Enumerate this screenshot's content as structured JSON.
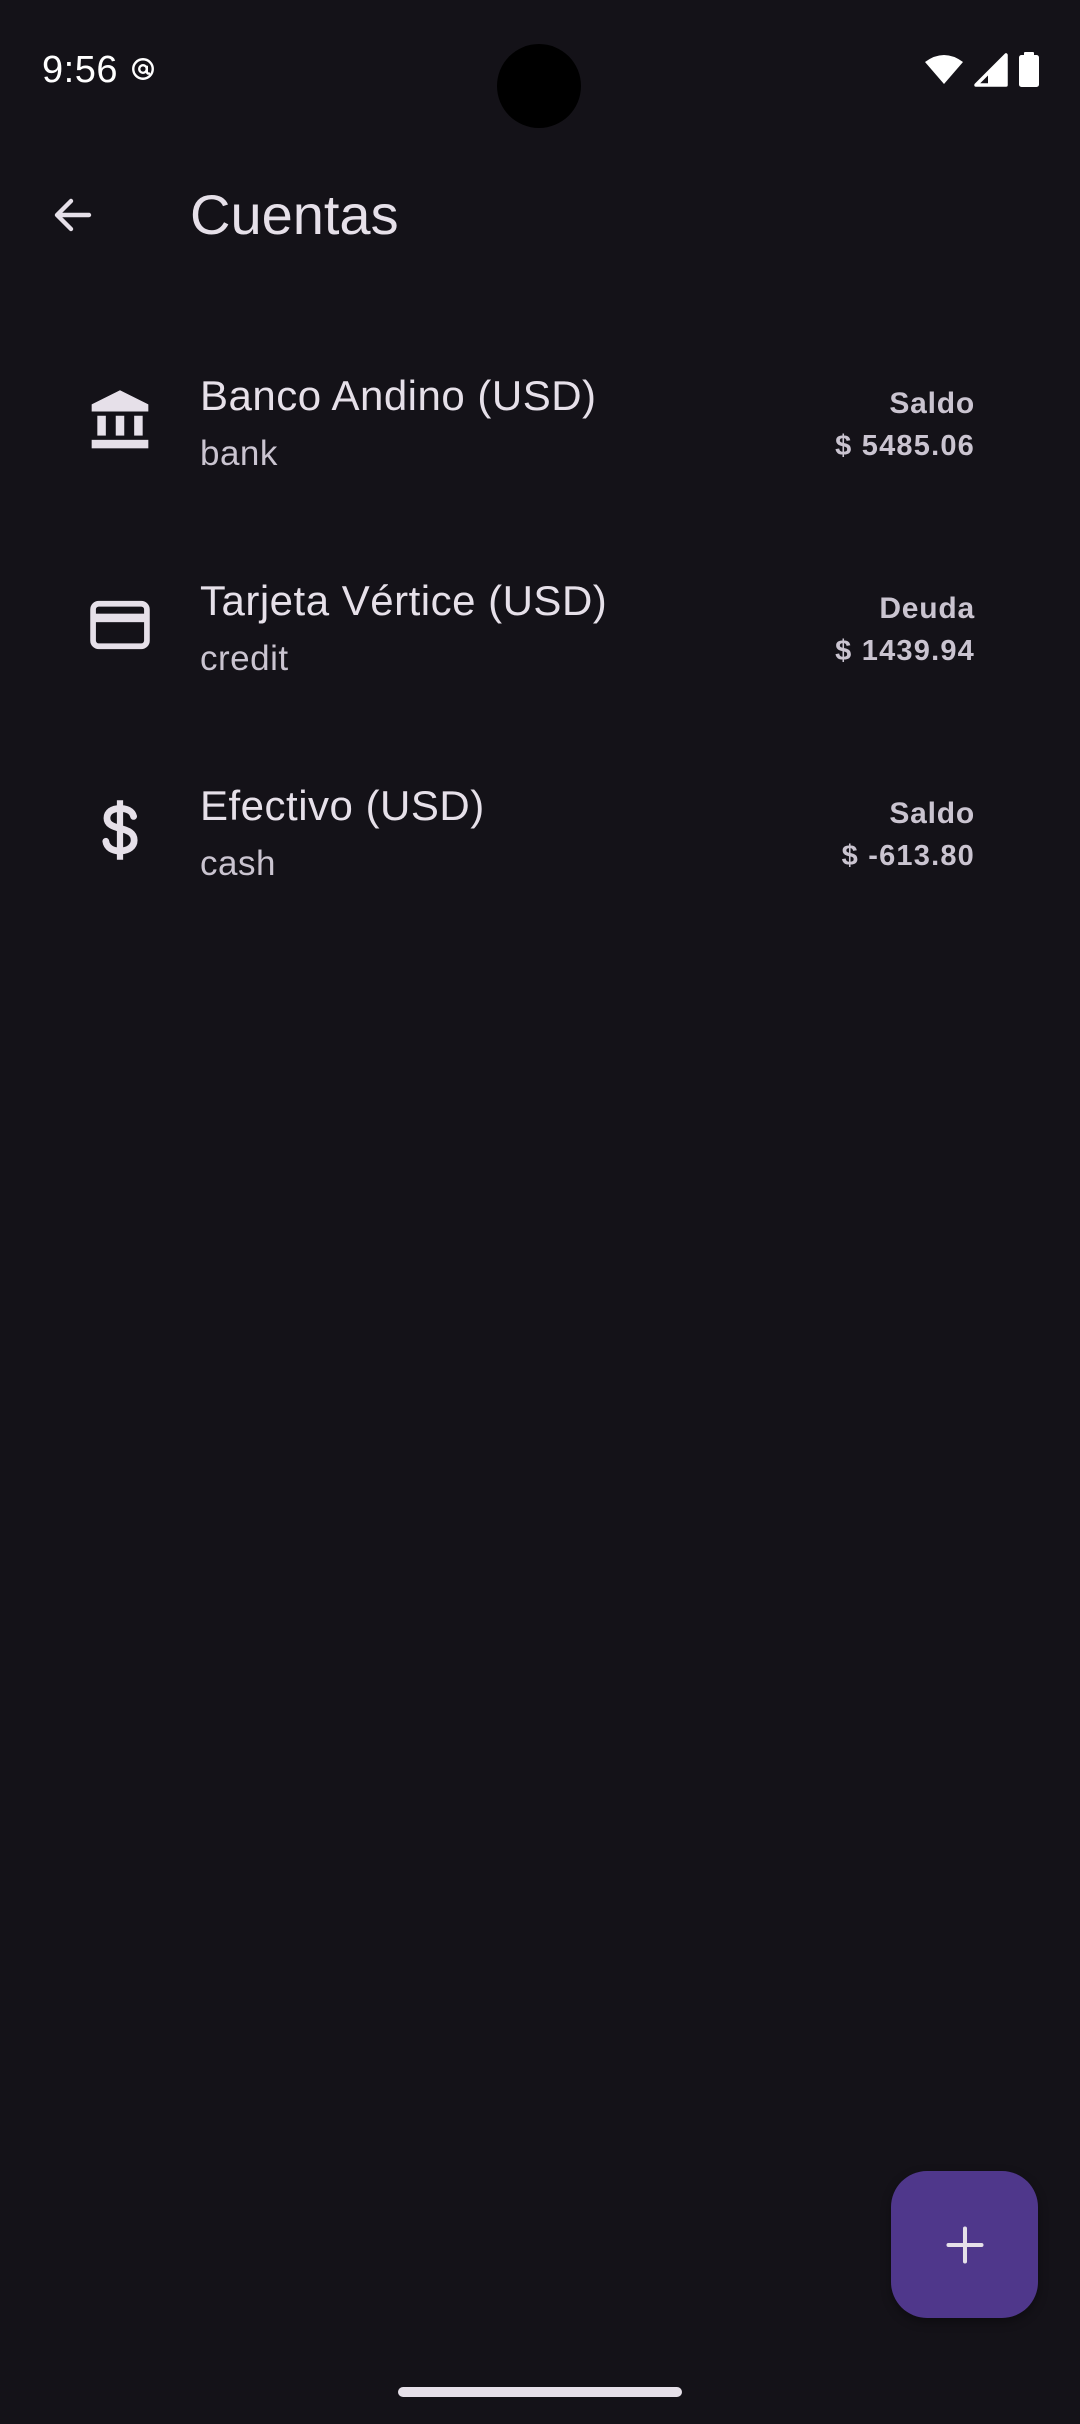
{
  "status_bar": {
    "time": "9:56",
    "app_icon": "at-sign-icon",
    "icons": [
      "wifi-icon",
      "cell-signal-icon",
      "battery-icon"
    ]
  },
  "app_bar": {
    "back_icon": "arrow-back-icon",
    "title": "Cuentas"
  },
  "accounts": [
    {
      "icon": "bank-icon",
      "name": "Banco Andino (USD)",
      "type": "bank",
      "amount_label": "Saldo",
      "amount": "$ 5485.06"
    },
    {
      "icon": "credit-card-icon",
      "name": "Tarjeta Vértice (USD)",
      "type": "credit",
      "amount_label": "Deuda",
      "amount": "$ 1439.94"
    },
    {
      "icon": "dollar-icon",
      "name": "Efectivo (USD)",
      "type": "cash",
      "amount_label": "Saldo",
      "amount": "$ -613.80"
    }
  ],
  "fab": {
    "icon": "add-icon"
  },
  "colors": {
    "background": "#141218",
    "on_surface": "#e6e0e9",
    "on_surface_variant": "#cac4d0",
    "fab": "#4f378b"
  }
}
